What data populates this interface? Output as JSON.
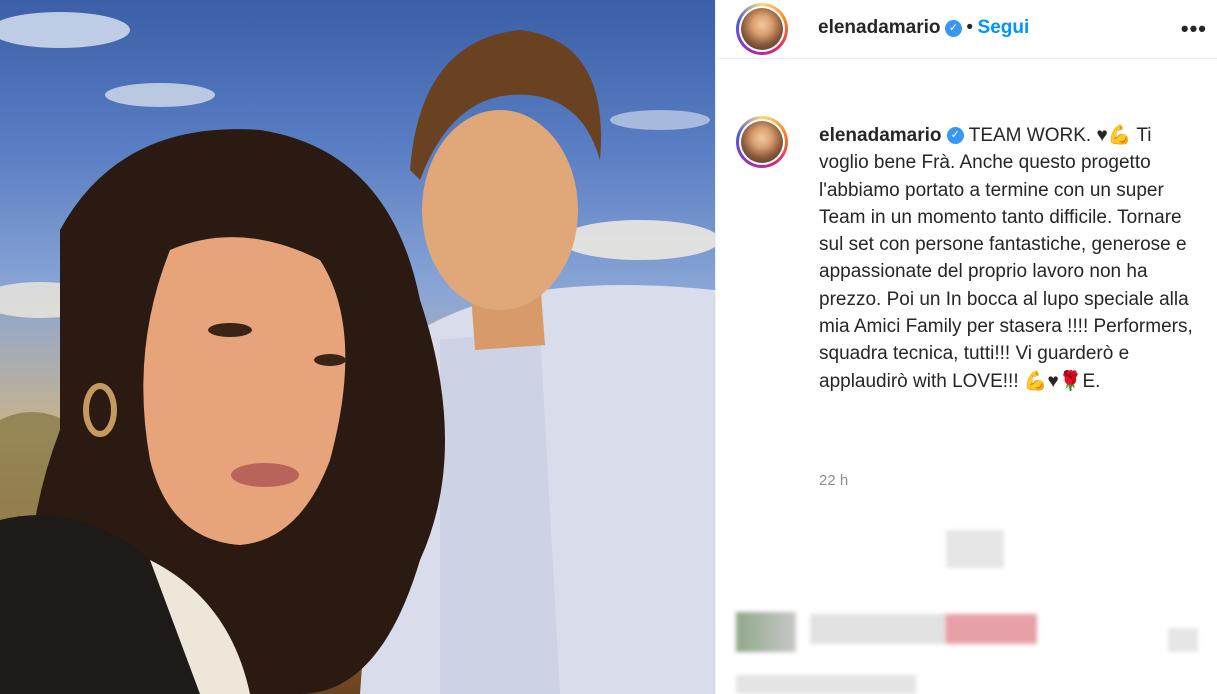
{
  "post": {
    "username": "elenadamario",
    "follow_label": "Segui",
    "separator": "•",
    "more_label": "•••",
    "verified_glyph": "✓",
    "caption": "TEAM WORK. ♥💪 Ti voglio bene Frà. Anche questo progetto l'abbiamo portato a termine con un super Team in un momento tanto difficile. Tornare sul set con persone fantastiche, generose e appassionate del proprio lavoro non ha prezzo. Poi un In bocca al lupo speciale alla mia Amici Family per stasera !!!! Performers, squadra tecnica, tutti!!! Vi guarderò e applaudirò with LOVE!!! 💪♥🌹E.",
    "time": "22 h"
  },
  "colors": {
    "accent": "#0095f6",
    "verified": "#3897f0",
    "muted": "#8e8e8e"
  },
  "icons": {
    "verified": "verified-badge-icon",
    "more": "more-options-icon"
  }
}
